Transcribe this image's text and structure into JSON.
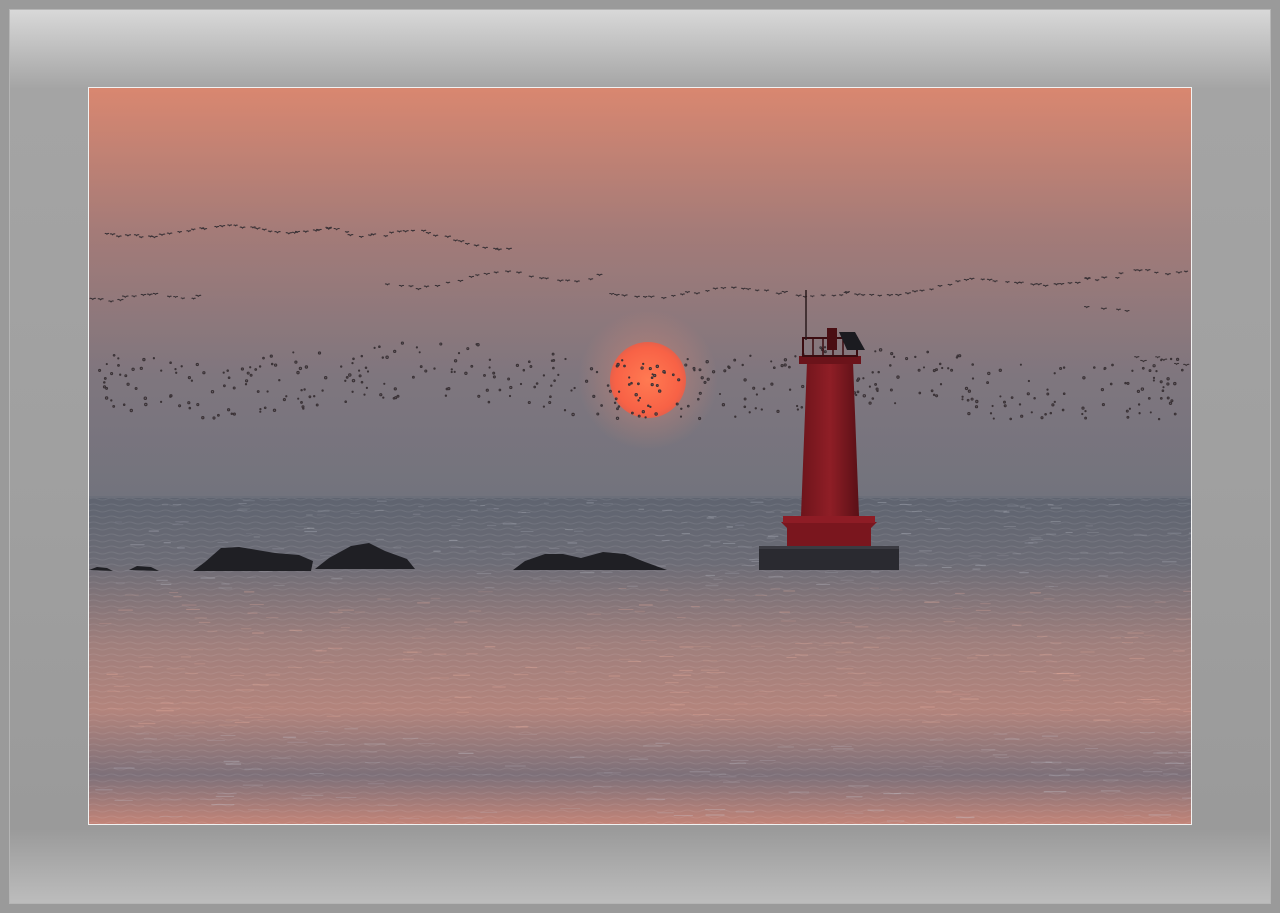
{
  "scene": {
    "subject": "sunset-lighthouse-seascape",
    "colors": {
      "sky_top": "#e08a6e",
      "sky_mid": "#9c7a7c",
      "sky_horizon": "#757580",
      "sea": "#6b6d78",
      "sea_glow": "#d99380",
      "sun": "#ff6a48",
      "lighthouse": "#8a1a22",
      "rock": "#1e1e22",
      "mat": "#a0a0a0"
    }
  }
}
